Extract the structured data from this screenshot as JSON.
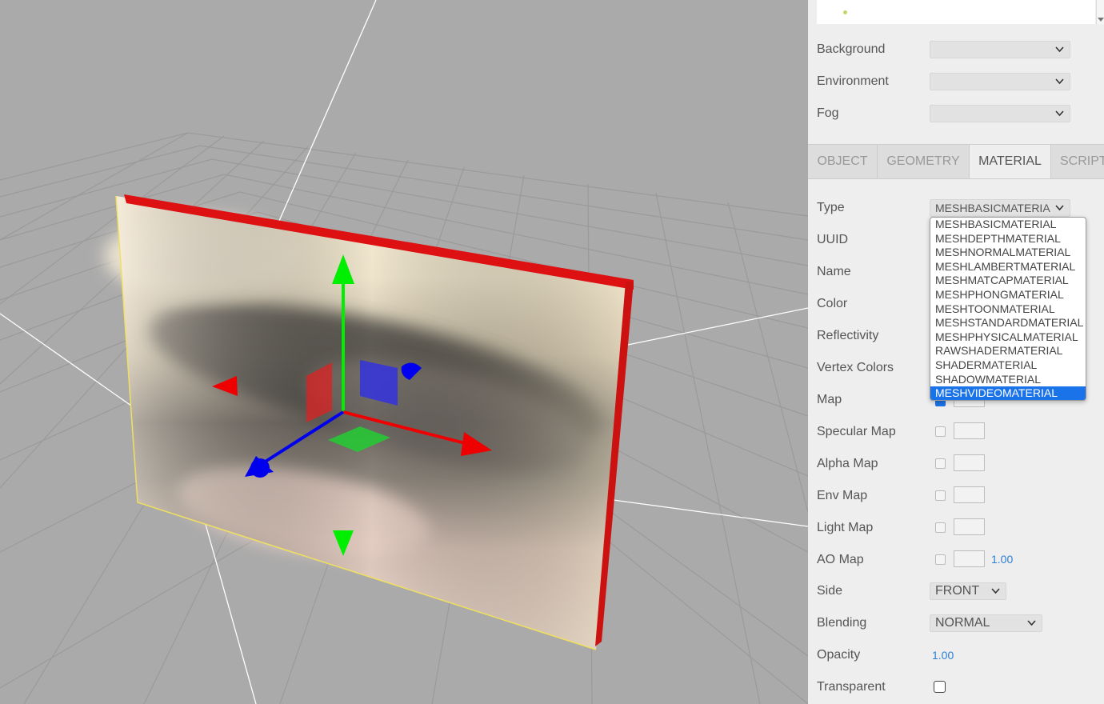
{
  "scene": {
    "background_label": "Background",
    "environment_label": "Environment",
    "fog_label": "Fog"
  },
  "tabs": [
    {
      "label": "OBJECT"
    },
    {
      "label": "GEOMETRY"
    },
    {
      "label": "MATERIAL"
    },
    {
      "label": "SCRIPT"
    }
  ],
  "material": {
    "type_label": "Type",
    "type_value": "MESHBASICMATERIA",
    "uuid_label": "UUID",
    "name_label": "Name",
    "color_label": "Color",
    "reflectivity_label": "Reflectivity",
    "vertex_colors_label": "Vertex Colors",
    "map_label": "Map",
    "specular_map_label": "Specular Map",
    "alpha_map_label": "Alpha Map",
    "env_map_label": "Env Map",
    "light_map_label": "Light Map",
    "ao_map_label": "AO Map",
    "ao_map_value": "1.00",
    "side_label": "Side",
    "side_value": "FRONT",
    "blending_label": "Blending",
    "blending_value": "NORMAL",
    "opacity_label": "Opacity",
    "opacity_value": "1.00",
    "transparent_label": "Transparent"
  },
  "type_options": [
    "MESHBASICMATERIAL",
    "MESHDEPTHMATERIAL",
    "MESHNORMALMATERIAL",
    "MESHLAMBERTMATERIAL",
    "MESHMATCAPMATERIAL",
    "MESHPHONGMATERIAL",
    "MESHTOONMATERIAL",
    "MESHSTANDARDMATERIAL",
    "MESHPHYSICALMATERIAL",
    "RAWSHADERMATERIAL",
    "SHADERMATERIAL",
    "SHADOWMATERIAL",
    "MESHVIDEOMATERIAL"
  ],
  "type_selected_index": 12,
  "colors": {
    "accent": "#1a73e8",
    "number": "#2a7fd4",
    "gizmo_x": "#ff0000",
    "gizmo_y": "#00ff00",
    "gizmo_z": "#0000ff"
  }
}
